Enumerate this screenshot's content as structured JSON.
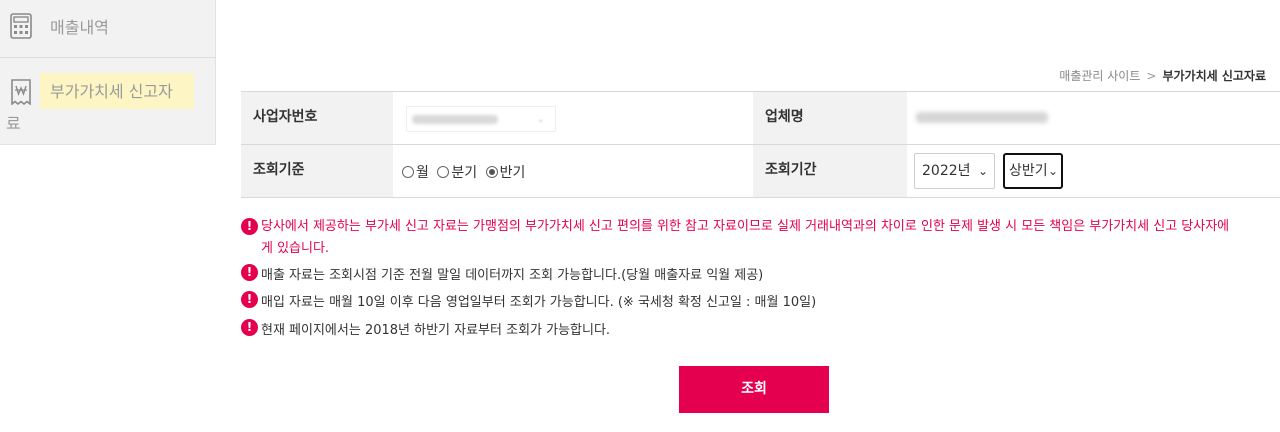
{
  "sidebar": {
    "items": [
      {
        "label": "매출내역",
        "icon": "calculator-icon"
      },
      {
        "label_line1": "부가가치세 신고자",
        "label_line2": "료",
        "icon": "receipt-won-icon"
      }
    ]
  },
  "breadcrumb": {
    "parent": "매출관리 사이트",
    "separator": ">",
    "current": "부가가치세 신고자료"
  },
  "form": {
    "business_number_label": "사업자번호",
    "company_name_label": "업체명",
    "criteria_label": "조회기준",
    "criteria_options": [
      "월",
      "분기",
      "반기"
    ],
    "criteria_selected": "반기",
    "period_label": "조회기간",
    "year_value": "2022년",
    "half_value": "상반기"
  },
  "notices": {
    "line1": "당사에서 제공하는 부가세 신고 자료는 가맹점의 부가가치세 신고 편의를 위한 참고 자료이므로 실제 거래내역과의 차이로 인한 문제 발생 시 모든 책임은 부가가치세 신고 당사자에게 있습니다.",
    "line2": "매출 자료는 조회시점 기준 전월 말일 데이터까지 조회 가능합니다.(당월 매출자료 익월 제공)",
    "line3": "매입 자료는 매월 10일 이후 다음 영업일부터 조회가 가능합니다. (※ 국세청 확정 신고일 : 매월 10일)",
    "line4": "현재 페이지에서는 2018년 하반기 자료부터 조회가 가능합니다."
  },
  "search_button": "조회",
  "colors": {
    "accent": "#e5004f",
    "highlight": "#fdf6c4",
    "header_bg": "#f2f2f2"
  }
}
